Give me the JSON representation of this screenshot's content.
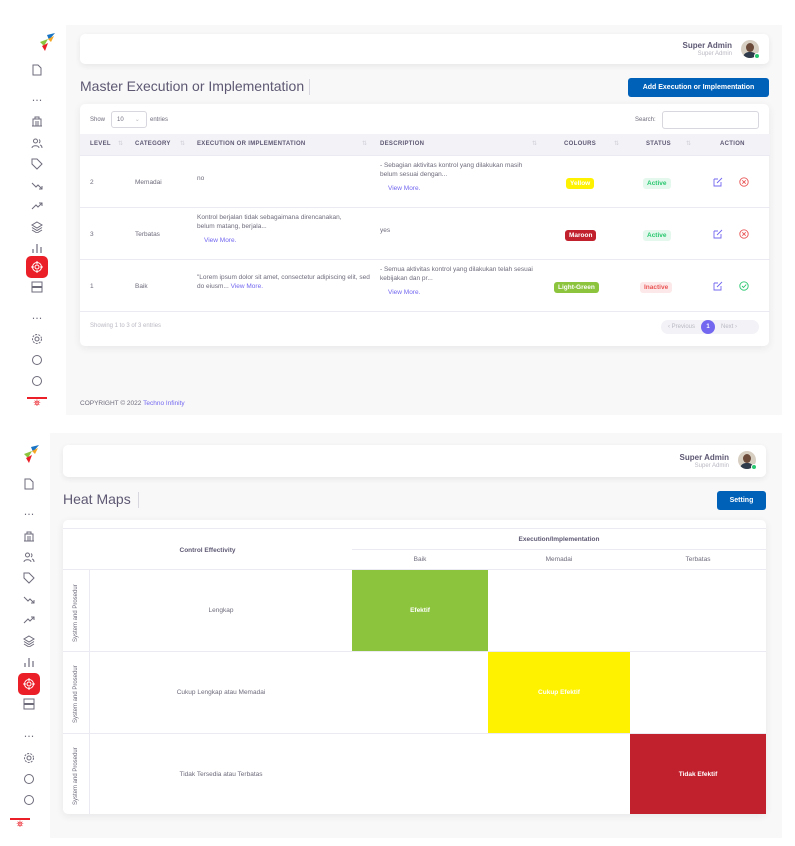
{
  "user": {
    "name": "Super Admin",
    "role": "Super Admin"
  },
  "colors": {
    "primary": "#0061b8",
    "brand_red": "#ea1f28",
    "yellow": "#fff200",
    "maroon": "#c1202d",
    "light_green": "#8cc43d",
    "active": "#28c76f",
    "inactive": "#ea5455"
  },
  "sidebar_icons": [
    "file-icon",
    "more-icon",
    "building-icon",
    "users-icon",
    "tag-icon",
    "trend-down-icon",
    "trend-up-icon",
    "layers-icon",
    "bar-chart-icon",
    "target-icon",
    "server-icon",
    "more-icon",
    "settings-icon",
    "circle-icon",
    "circle-icon"
  ],
  "screen1": {
    "title": "Master Execution or Implementation",
    "add_button": "Add Execution or Implementation",
    "show_label": "Show",
    "entries_value": "10",
    "entries_label": "entries",
    "search_label": "Search:",
    "columns": [
      "LEVEL",
      "CATEGORY",
      "EXECUTION OR IMPLEMENTATION",
      "DESCRIPTION",
      "COLOURS",
      "STATUS",
      "ACTION"
    ],
    "rows": [
      {
        "level": "2",
        "category": "Memadai",
        "execution": "no",
        "execution_more": "",
        "description": "- Sebagian aktivitas kontrol yang dilakukan masih belum sesuai dengan...",
        "description_more": "View More.",
        "colour": "Yellow",
        "status": "Active"
      },
      {
        "level": "3",
        "category": "Terbatas",
        "execution": "Kontrol berjalan tidak sebagaimana direncanakan, belum matang, berjala...",
        "execution_more": "View More.",
        "description": "yes",
        "description_more": "",
        "colour": "Maroon",
        "status": "Active"
      },
      {
        "level": "1",
        "category": "Baik",
        "execution": "\"Lorem ipsum dolor sit amet, consectetur adipiscing elit, sed do eiusm...",
        "execution_more": "View More.",
        "description": "- Semua aktivitas kontrol yang dilakukan telah sesuai kebijakan dan pr...",
        "description_more": "View More.",
        "colour": "Light-Green",
        "status": "Inactive"
      }
    ],
    "showing": "Showing 1 to 3 of 3 entries",
    "pager": {
      "previous": "‹ Previous",
      "page": "1",
      "next": "Next ›"
    },
    "footer_prefix": "COPYRIGHT © 2022",
    "footer_link": "Techno Infinity"
  },
  "screen2": {
    "title": "Heat Maps",
    "setting_button": "Setting",
    "control_header": "Control Effectivity",
    "exec_header": "Execution/Implementation",
    "columns": [
      "Baik",
      "Memadai",
      "Terbatas"
    ],
    "row_group": "System and Prosedur",
    "rows": [
      {
        "label": "Lengkap",
        "cells": [
          "Efektif",
          "",
          ""
        ]
      },
      {
        "label": "Cukup Lengkap atau Memadai",
        "cells": [
          "",
          "Cukup Efektif",
          ""
        ]
      },
      {
        "label": "Tidak Tersedia atau Terbatas",
        "cells": [
          "",
          "",
          "Tidak Efektif"
        ]
      }
    ]
  }
}
